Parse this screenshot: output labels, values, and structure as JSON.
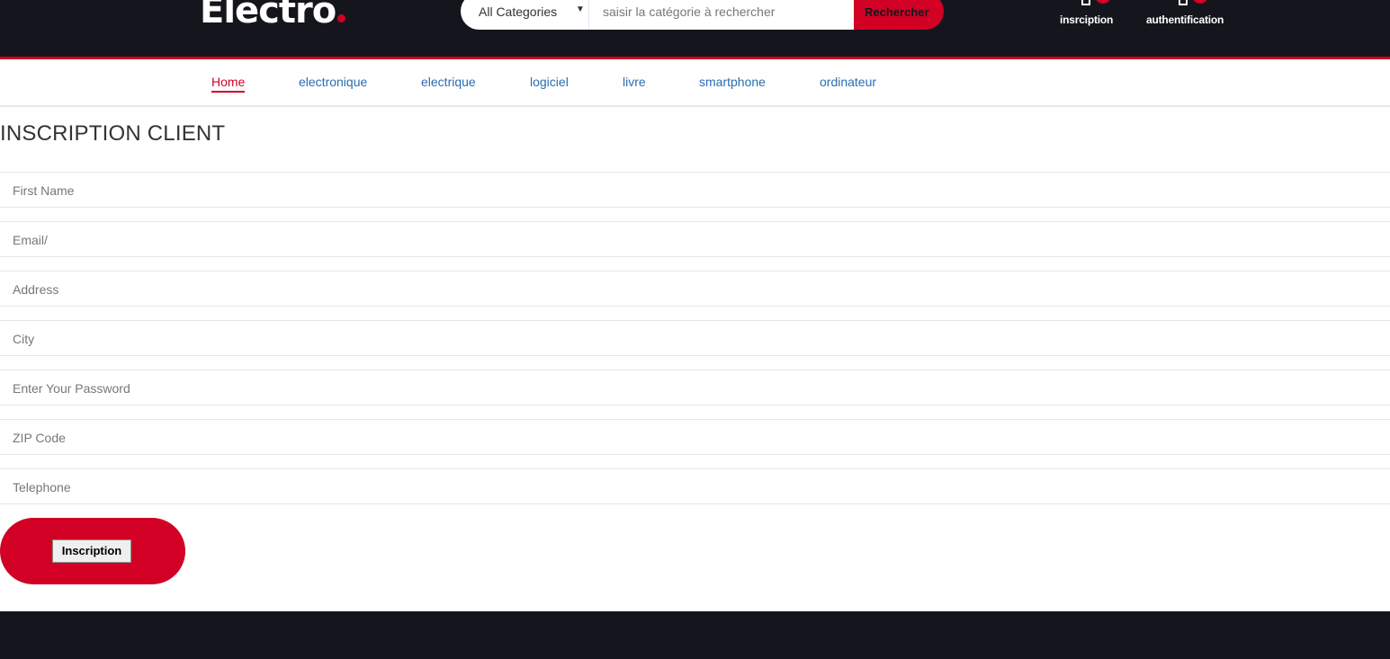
{
  "header": {
    "logo_text": "Electro",
    "search": {
      "category_selected": "All Categories",
      "placeholder": "saisir la catégorie à rechercher",
      "button_label": "Rechercher"
    },
    "links": [
      {
        "label": "insrciption",
        "icon": "user-icon"
      },
      {
        "label": "authentification",
        "icon": "lock-icon"
      }
    ]
  },
  "nav": {
    "items": [
      "Home",
      "electronique",
      "electrique",
      "logiciel",
      "livre",
      "smartphone",
      "ordinateur"
    ],
    "active": "Home"
  },
  "form": {
    "title": "INSCRIPTION CLIENT",
    "fields": [
      {
        "placeholder": "First Name"
      },
      {
        "placeholder": "Email/"
      },
      {
        "placeholder": "Address"
      },
      {
        "placeholder": "City"
      },
      {
        "placeholder": "Enter Your Password"
      },
      {
        "placeholder": "ZIP Code"
      },
      {
        "placeholder": "Telephone"
      }
    ],
    "submit_label": "Inscription"
  },
  "colors": {
    "brand_red": "#d10024",
    "header_dark": "#15161d",
    "nav_link": "#2b6cb0"
  }
}
